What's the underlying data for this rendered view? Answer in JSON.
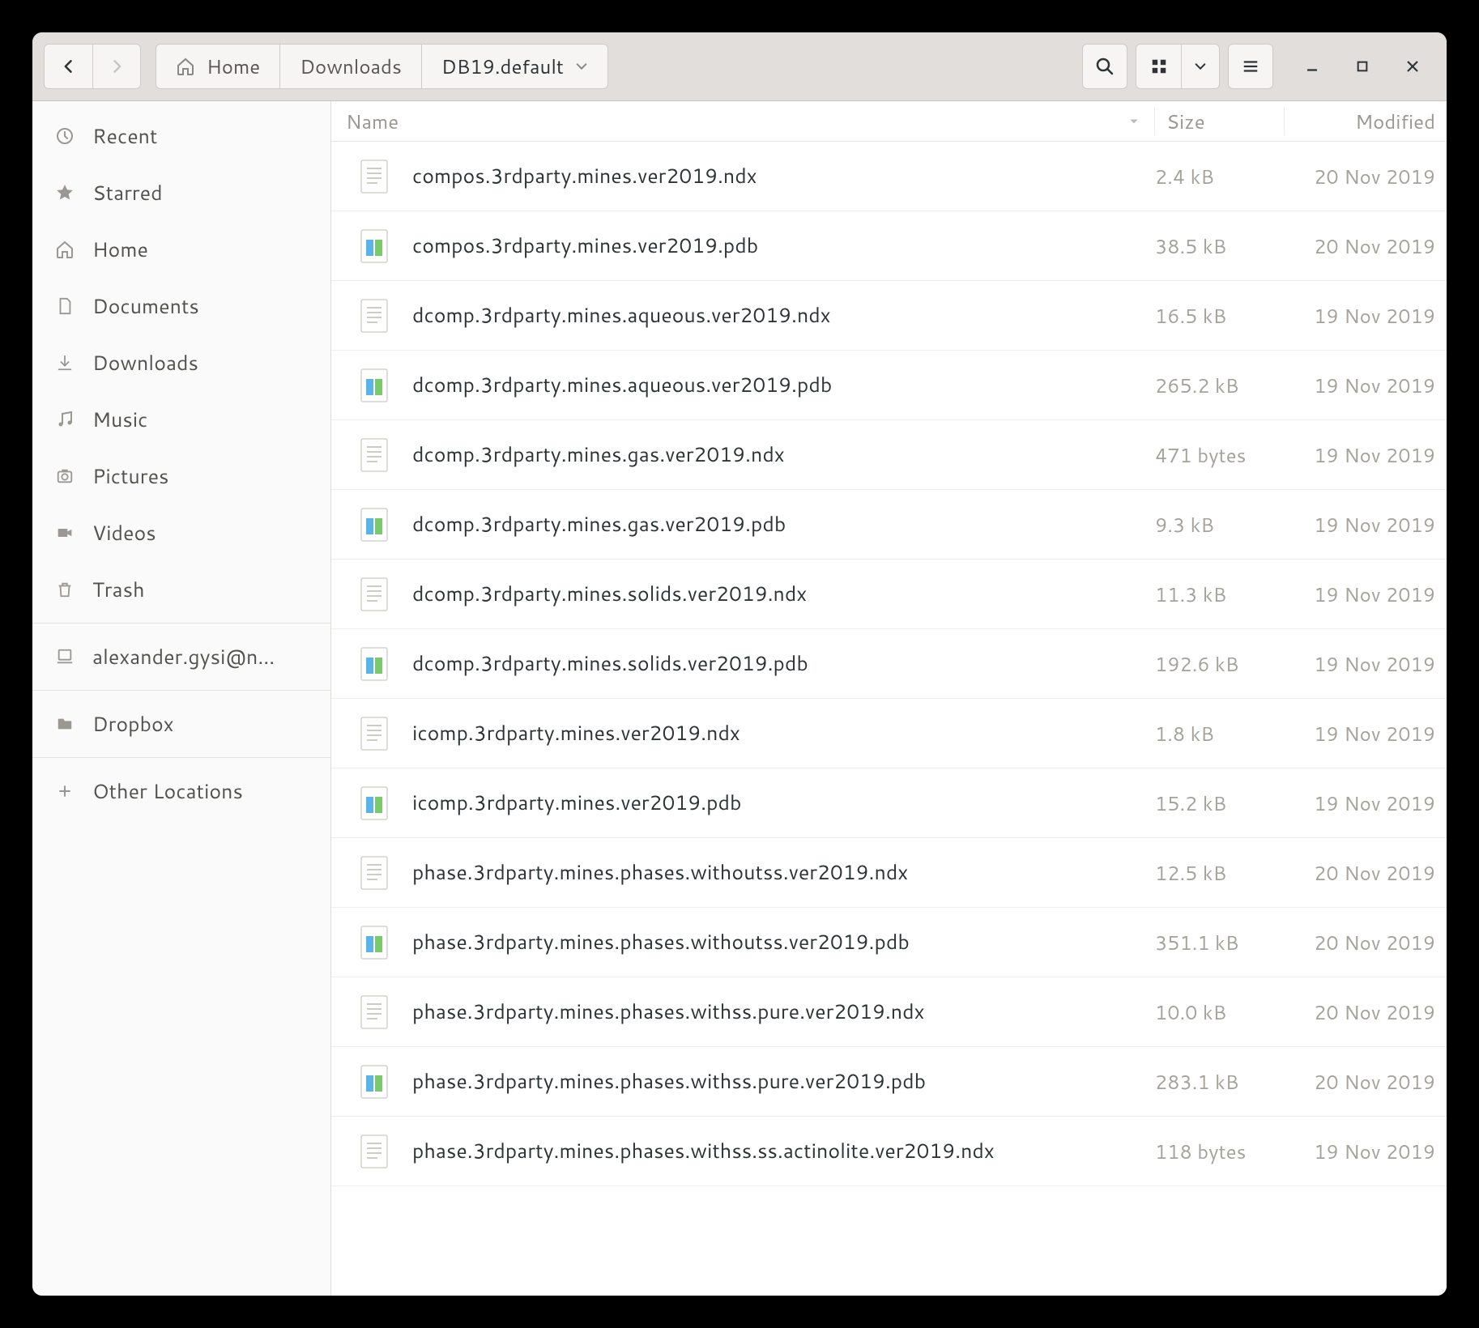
{
  "path": {
    "home_label": "Home",
    "segments": [
      "Downloads",
      "DB19.default"
    ]
  },
  "sidebar": {
    "items": [
      {
        "icon": "clock",
        "label": "Recent"
      },
      {
        "icon": "star",
        "label": "Starred"
      },
      {
        "icon": "home",
        "label": "Home"
      },
      {
        "icon": "doc",
        "label": "Documents"
      },
      {
        "icon": "down",
        "label": "Downloads"
      },
      {
        "icon": "music",
        "label": "Music"
      },
      {
        "icon": "camera",
        "label": "Pictures"
      },
      {
        "icon": "video",
        "label": "Videos"
      },
      {
        "icon": "trash",
        "label": "Trash"
      }
    ],
    "account_label": "alexander.gysi@n…",
    "dropbox_label": "Dropbox",
    "other_label": "Other Locations"
  },
  "columns": {
    "name": "Name",
    "size": "Size",
    "modified": "Modified"
  },
  "files": [
    {
      "type": "ndx",
      "name": "compos.3rdparty.mines.ver2019.ndx",
      "size": "2.4 kB",
      "modified": "20 Nov 2019"
    },
    {
      "type": "pdb",
      "name": "compos.3rdparty.mines.ver2019.pdb",
      "size": "38.5 kB",
      "modified": "20 Nov 2019"
    },
    {
      "type": "ndx",
      "name": "dcomp.3rdparty.mines.aqueous.ver2019.ndx",
      "size": "16.5 kB",
      "modified": "19 Nov 2019"
    },
    {
      "type": "pdb",
      "name": "dcomp.3rdparty.mines.aqueous.ver2019.pdb",
      "size": "265.2 kB",
      "modified": "19 Nov 2019"
    },
    {
      "type": "ndx",
      "name": "dcomp.3rdparty.mines.gas.ver2019.ndx",
      "size": "471 bytes",
      "modified": "19 Nov 2019"
    },
    {
      "type": "pdb",
      "name": "dcomp.3rdparty.mines.gas.ver2019.pdb",
      "size": "9.3 kB",
      "modified": "19 Nov 2019"
    },
    {
      "type": "ndx",
      "name": "dcomp.3rdparty.mines.solids.ver2019.ndx",
      "size": "11.3 kB",
      "modified": "19 Nov 2019"
    },
    {
      "type": "pdb",
      "name": "dcomp.3rdparty.mines.solids.ver2019.pdb",
      "size": "192.6 kB",
      "modified": "19 Nov 2019"
    },
    {
      "type": "ndx",
      "name": "icomp.3rdparty.mines.ver2019.ndx",
      "size": "1.8 kB",
      "modified": "19 Nov 2019"
    },
    {
      "type": "pdb",
      "name": "icomp.3rdparty.mines.ver2019.pdb",
      "size": "15.2 kB",
      "modified": "19 Nov 2019"
    },
    {
      "type": "ndx",
      "name": "phase.3rdparty.mines.phases.withoutss.ver2019.ndx",
      "size": "12.5 kB",
      "modified": "20 Nov 2019"
    },
    {
      "type": "pdb",
      "name": "phase.3rdparty.mines.phases.withoutss.ver2019.pdb",
      "size": "351.1 kB",
      "modified": "20 Nov 2019"
    },
    {
      "type": "ndx",
      "name": "phase.3rdparty.mines.phases.withss.pure.ver2019.ndx",
      "size": "10.0 kB",
      "modified": "20 Nov 2019"
    },
    {
      "type": "pdb",
      "name": "phase.3rdparty.mines.phases.withss.pure.ver2019.pdb",
      "size": "283.1 kB",
      "modified": "20 Nov 2019"
    },
    {
      "type": "ndx",
      "name": "phase.3rdparty.mines.phases.withss.ss.actinolite.ver2019.ndx",
      "size": "118 bytes",
      "modified": "19 Nov 2019"
    }
  ]
}
